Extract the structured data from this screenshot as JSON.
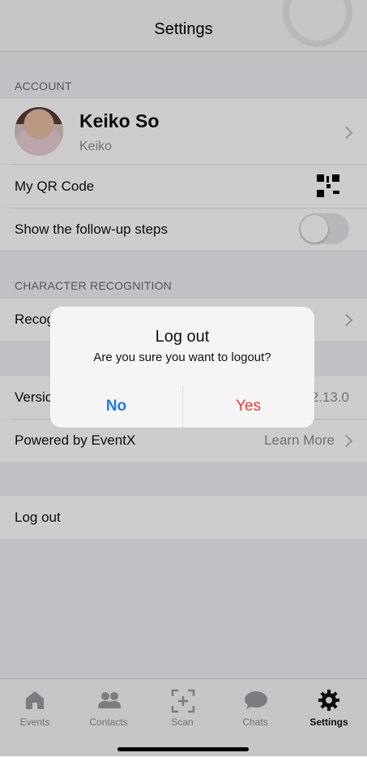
{
  "header": {
    "title": "Settings"
  },
  "account": {
    "section": "ACCOUNT",
    "name": "Keiko So",
    "username": "Keiko",
    "qr_label": "My QR Code",
    "followup_label": "Show the follow-up steps"
  },
  "recognition": {
    "section": "CHARACTER RECOGNITION",
    "label": "Recog"
  },
  "about": {
    "version_label": "Versic",
    "version_value": "2.13.0",
    "powered_label": "Powered by EventX",
    "learn_more": "Learn More"
  },
  "logout_label": "Log out",
  "tabs": [
    {
      "label": "Events",
      "icon": "house-icon"
    },
    {
      "label": "Contacts",
      "icon": "people-icon"
    },
    {
      "label": "Scan",
      "icon": "scan-icon"
    },
    {
      "label": "Chats",
      "icon": "chat-icon"
    },
    {
      "label": "Settings",
      "icon": "gear-icon"
    }
  ],
  "active_tab": "Settings",
  "dialog": {
    "title": "Log out",
    "message": "Are you sure you want to logout?",
    "no_label": "No",
    "yes_label": "Yes",
    "no_color": "#1f7ae0",
    "yes_color": "#e53935"
  },
  "colors": {
    "logout_red": "#d0021b"
  }
}
